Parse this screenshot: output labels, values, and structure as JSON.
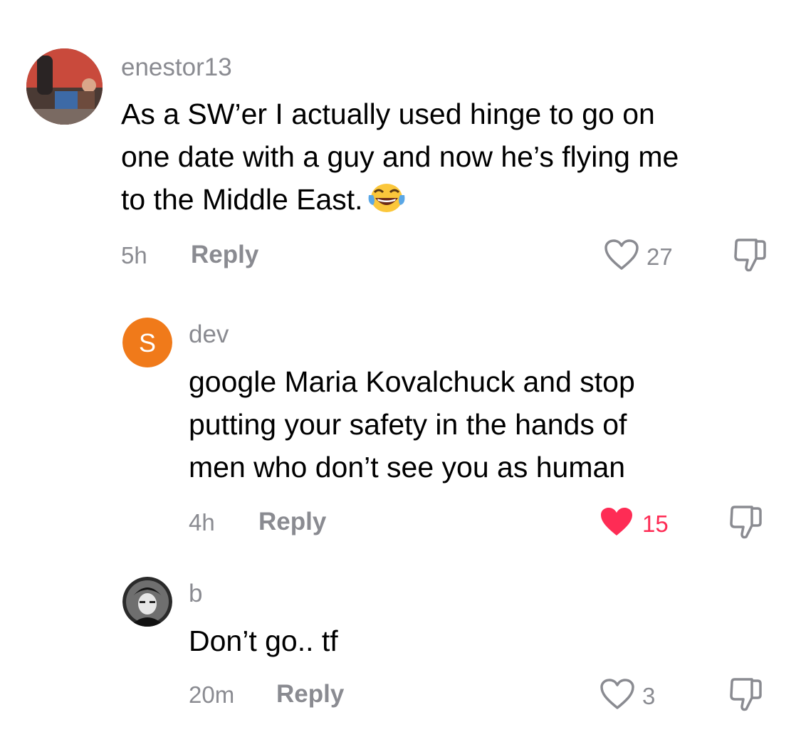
{
  "comments": [
    {
      "username": "enestor13",
      "text_lines": [
        "As a SW’er I actually used hinge to go on",
        "one date with a guy and now he’s flying me",
        "to the Middle East."
      ],
      "emoji": "face-with-tears-of-joy",
      "time": "5h",
      "reply_label": "Reply",
      "likes": "27",
      "liked": false
    },
    {
      "username": "dev",
      "avatar_letter": "S",
      "avatar_color": "#f07a1a",
      "text_lines": [
        "google Maria Kovalchuck and stop",
        "putting your safety in the hands of",
        "men who don’t see you as human"
      ],
      "time": "4h",
      "reply_label": "Reply",
      "likes": "15",
      "liked": true
    },
    {
      "username": "b",
      "text_lines": [
        "Don’t go.. tf"
      ],
      "time": "20m",
      "reply_label": "Reply",
      "likes": "3",
      "liked": false
    }
  ],
  "colors": {
    "secondary_text": "#8a8b91",
    "like_active": "#fe2c55"
  }
}
